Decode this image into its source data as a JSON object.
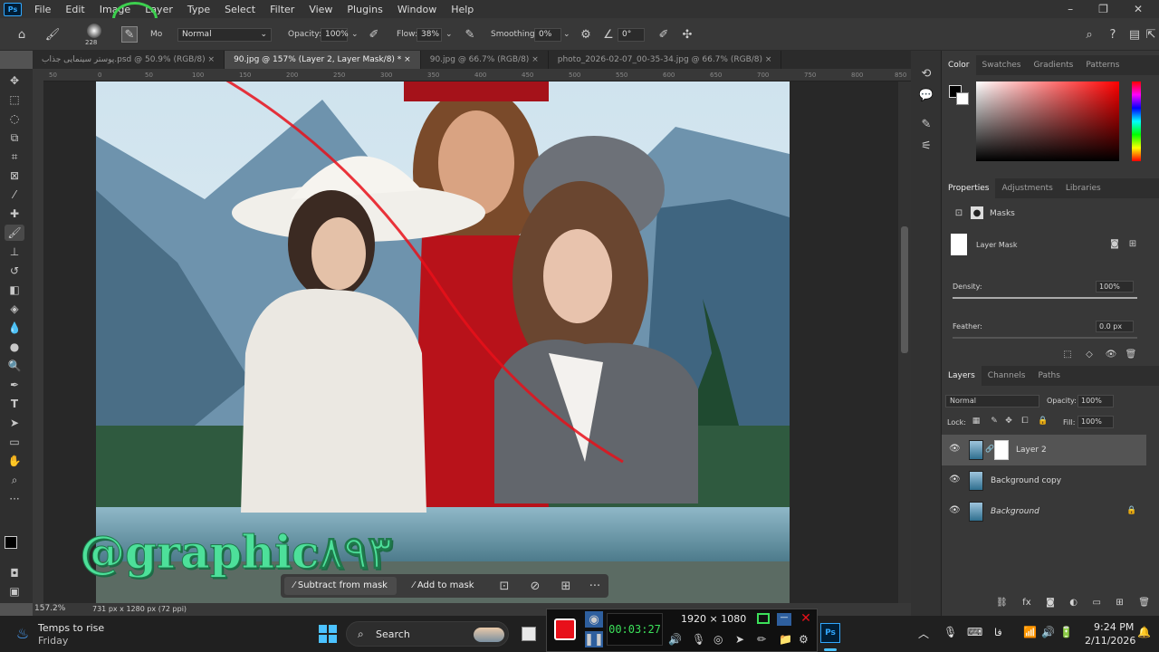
{
  "menubar": {
    "app_icon": "Ps",
    "items": [
      "File",
      "Edit",
      "Image",
      "Layer",
      "Type",
      "Select",
      "Filter",
      "View",
      "Plugins",
      "Window",
      "Help"
    ],
    "window_controls": [
      "–",
      "❐",
      "✕"
    ]
  },
  "options": {
    "brush_size": "228",
    "mode_label": "Mo",
    "mode": "Normal",
    "opacity_label": "Opacity:",
    "opacity": "100%",
    "flow_label": "Flow:",
    "flow": "38%",
    "smoothing_label": "Smoothing:",
    "smoothing": "0%",
    "angle": "0°"
  },
  "tabs": [
    "پوستر سینمایی جذاب.psd @ 50.9% (RGB/8)",
    "90.jpg @ 157% (Layer 2, Layer Mask/8) *",
    "90.jpg @ 66.7% (RGB/8)",
    "photo_2026-02-07_00-35-34.jpg @ 66.7% (RGB/8)"
  ],
  "ruler_ticks": [
    "50",
    "0",
    "50",
    "100",
    "150",
    "200",
    "250",
    "300",
    "350",
    "400",
    "450",
    "500",
    "550",
    "600",
    "650",
    "700",
    "750",
    "800",
    "850"
  ],
  "watermark": "@graphic۸۹۳",
  "floatbar": {
    "subtract": "Subtract from mask",
    "add": "Add to mask",
    "more": "···"
  },
  "status": {
    "zoom": "157.2%",
    "doc_info": "731 px x 1280 px (72 ppi)"
  },
  "color_panel": {
    "tabs": [
      "Color",
      "Swatches",
      "Gradients",
      "Patterns"
    ],
    "active": "Color",
    "hue_accent": "#ff0000"
  },
  "properties": {
    "tabs": [
      "Properties",
      "Adjustments",
      "Libraries"
    ],
    "section": "Masks",
    "mask_name": "Layer Mask",
    "density_label": "Density:",
    "density": "100%",
    "density_level": 1.0,
    "feather_label": "Feather:",
    "feather": "0.0 px",
    "feather_level": 0.0
  },
  "layers_panel": {
    "tabs": [
      "Layers",
      "Channels",
      "Paths"
    ],
    "blend_mode": "Normal",
    "opacity_label": "Opacity:",
    "opacity": "100%",
    "lock_label": "Lock:",
    "fill_label": "Fill:",
    "fill": "100%",
    "layers": [
      {
        "name": "Layer 2",
        "selected": true,
        "mask": true
      },
      {
        "name": "Background copy",
        "selected": false,
        "mask": false
      },
      {
        "name": "Background",
        "selected": false,
        "mask": false,
        "locked": true
      }
    ]
  },
  "taskbar": {
    "weather_title": "Temps to rise",
    "weather_sub": "Friday",
    "search": "Search",
    "time": "9:24 PM",
    "date": "2/11/2026",
    "lang": "فا"
  },
  "recorder": {
    "timer": "00:03:27",
    "resolution": "1920 × 1080"
  },
  "colors": {
    "accent_red": "#e8101a",
    "ps_blue": "#31a8ff",
    "watermark_green": "#4de09a"
  }
}
